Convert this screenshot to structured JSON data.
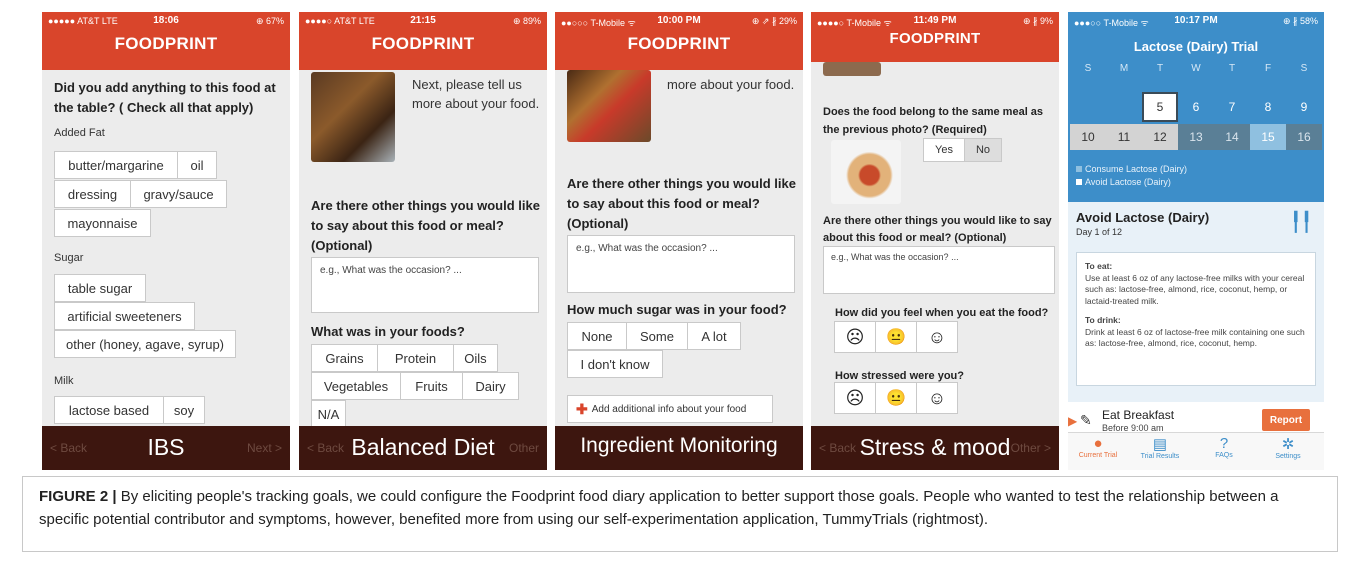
{
  "phones": {
    "ibs": {
      "status": {
        "carrier": "●●●●● AT&T  LTE",
        "time": "18:06",
        "battery": "⊕ 67%"
      },
      "app_title": "FOODPRINT",
      "question": "Did you add anything to this food at the table? ( Check all that apply)",
      "groups": [
        {
          "label": "Added Fat",
          "options": [
            "butter/margarine",
            "oil",
            "dressing",
            "gravy/sauce",
            "mayonnaise"
          ]
        },
        {
          "label": "Sugar",
          "options": [
            "table sugar",
            "artificial sweeteners",
            "other (honey, agave, syrup)"
          ]
        },
        {
          "label": "Milk",
          "options": [
            "lactose based",
            "soy"
          ]
        }
      ],
      "nav": {
        "back": "< Back",
        "next": "Next >"
      },
      "goal": "IBS"
    },
    "balanced": {
      "status": {
        "carrier": "●●●●○ AT&T  LTE",
        "time": "21:15",
        "battery": "⊕ 89%"
      },
      "app_title": "FOODPRINT",
      "intro": "Next, please tell us more about your food.",
      "question": "Are there other things you would like to say about this food or meal? (Optional)",
      "placeholder": "e.g., What was the occasion? ...",
      "question2": "What was in your foods?",
      "options": [
        "Grains",
        "Protein",
        "Oils",
        "Vegetables",
        "Fruits",
        "Dairy",
        "N/A"
      ],
      "nav": {
        "back": "< Back",
        "next": "Other"
      },
      "goal": "Balanced Diet"
    },
    "ingredient": {
      "status": {
        "carrier": "●●○○○ T-Mobile ᯤ",
        "time": "10:00 PM",
        "battery": "⊕ ⇗ ∦ 29%"
      },
      "app_title": "FOODPRINT",
      "intro": "more about your food.",
      "question": "Are there other things you would like to say about this food or meal? (Optional)",
      "placeholder": "e.g., What was the occasion? ...",
      "question2": "How much sugar was in your food?",
      "options": [
        "None",
        "Some",
        "A lot",
        "I don't know"
      ],
      "add_info": "Add additional info about your food",
      "goal": "Ingredient Monitoring"
    },
    "stress": {
      "status": {
        "carrier": "●●●●○ T-Mobile ᯤ",
        "time": "11:49 PM",
        "battery": "⊕ ∦ 9%"
      },
      "app_title": "FOODPRINT",
      "question": "Does the food belong to the same meal as the previous photo? (Required)",
      "yes": "Yes",
      "no": "No",
      "question2": "Are there other things you would like to say about this food or meal? (Optional)",
      "placeholder": "e.g., What was the occasion? ...",
      "feel_q": "How did you feel when you eat the food?",
      "stress_q": "How stressed were you?",
      "faces": [
        "☹",
        "😐",
        "☺"
      ],
      "nav": {
        "back": "< Back",
        "next": "Other >"
      },
      "goal": "Stress & mood"
    },
    "tummy": {
      "status": {
        "carrier": "●●●○○ T-Mobile ᯤ",
        "time": "10:17 PM",
        "battery": "⊕ ∦ 58%"
      },
      "title": "Lactose (Dairy) Trial",
      "weekdays": [
        "S",
        "M",
        "T",
        "W",
        "T",
        "F",
        "S"
      ],
      "week1": [
        "",
        "",
        "5",
        "6",
        "7",
        "8",
        "9"
      ],
      "week2": [
        "10",
        "11",
        "12",
        "13",
        "14",
        "15",
        "16"
      ],
      "legend": [
        "Consume Lactose (Dairy)",
        "Avoid Lactose (Dairy)"
      ],
      "card_title": "Avoid Lactose (Dairy)",
      "card_sub": "Day 1 of 12",
      "eat_h": "To eat:",
      "eat_t": "Use at least 6 oz of any lactose-free milks with your cereal such as: lactose-free, almond, rice, coconut, hemp, or lactaid-treated milk.",
      "drink_h": "To drink:",
      "drink_t": "Drink at least 6 oz of lactose-free milk containing one such as: lactose-free, almond, rice, coconut, hemp.",
      "task": "Eat Breakfast",
      "task_time": "Before 9:00 am",
      "report": "Report",
      "tabs": [
        "Current Trial",
        "Trial Results",
        "FAQs",
        "Settings"
      ]
    }
  },
  "caption": {
    "label": "FIGURE 2 |",
    "text": "By eliciting people's tracking goals, we could configure the Foodprint food diary application to better support those goals. People who wanted to test the relationship between a specific potential contributor and symptoms, however, benefited more from using our self-experimentation application, TummyTrials (rightmost)."
  },
  "colors": {
    "foodprint_red": "#d9452b",
    "banner": "#3d160f",
    "tummy_blue": "#3d8ec9",
    "report_orange": "#e8703d"
  }
}
